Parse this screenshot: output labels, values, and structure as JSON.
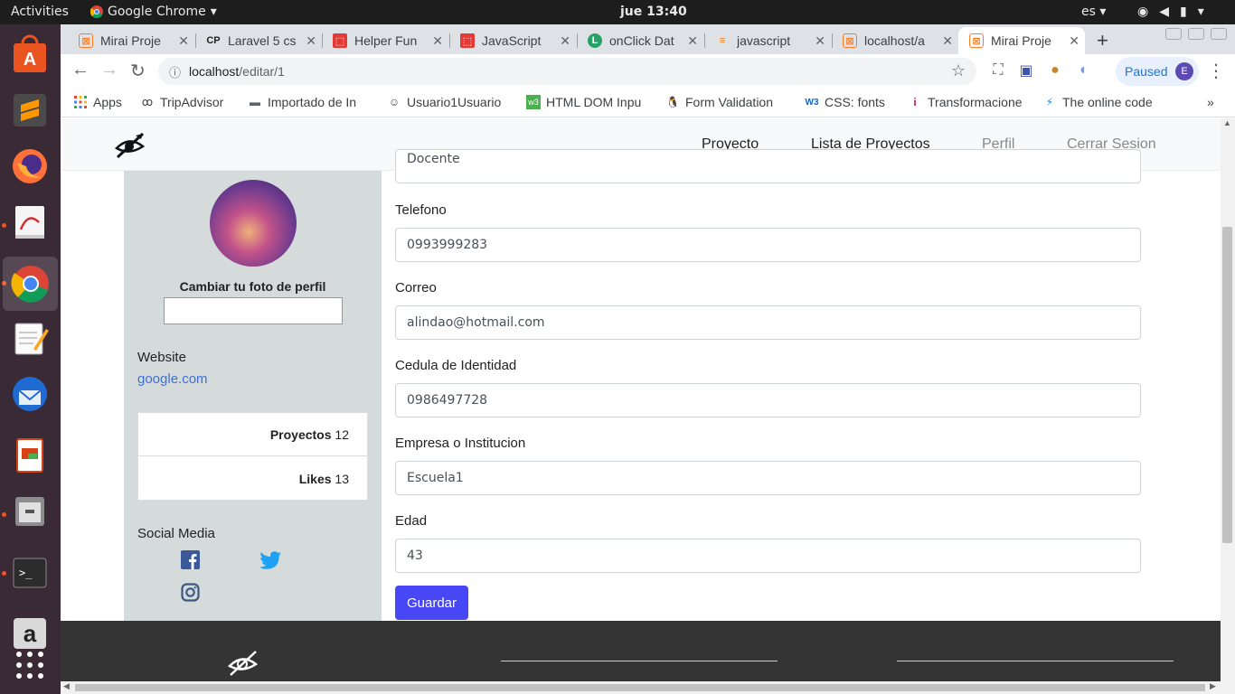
{
  "os": {
    "activities": "Activities",
    "app_name": "Google Chrome",
    "clock": "jue 13:40",
    "lang": "es"
  },
  "tabs": [
    {
      "title": "Mirai Proje",
      "favicon": "xampp-icon",
      "active": false
    },
    {
      "title": "Laravel 5 cs",
      "favicon": "cp-icon",
      "active": false
    },
    {
      "title": "Helper Fun",
      "favicon": "laravel-icon",
      "active": false
    },
    {
      "title": "JavaScript",
      "favicon": "laravel-icon",
      "active": false
    },
    {
      "title": "onClick Dat",
      "favicon": "l-icon",
      "active": false
    },
    {
      "title": "javascript",
      "favicon": "stackoverflow-icon",
      "active": false
    },
    {
      "title": "localhost/a",
      "favicon": "xampp-icon",
      "active": false
    },
    {
      "title": "Mirai Proje",
      "favicon": "xampp-icon",
      "active": true
    }
  ],
  "omnibox": {
    "host": "localhost",
    "path": "/editar/1"
  },
  "profile": {
    "label": "Paused",
    "initial": "E"
  },
  "bookmarks": [
    {
      "label": "Apps"
    },
    {
      "label": "TripAdvisor"
    },
    {
      "label": "Importado de In"
    },
    {
      "label": "Usuario1Usuario"
    },
    {
      "label": "HTML DOM Inpu"
    },
    {
      "label": "Form Validation"
    },
    {
      "label": "CSS: fonts"
    },
    {
      "label": "Transformacione"
    },
    {
      "label": "The online code"
    }
  ],
  "navbar": {
    "links": [
      "Proyecto",
      "Lista de Proyectos",
      "Perfil",
      "Cerrar Sesion"
    ]
  },
  "sidebar": {
    "change_photo": "Cambiar tu foto de perfil",
    "website_label": "Website",
    "website_link": "google.com",
    "stats": [
      {
        "label": "Proyectos",
        "value": "12"
      },
      {
        "label": "Likes",
        "value": "13"
      }
    ],
    "social_label": "Social Media"
  },
  "form": {
    "fields": [
      {
        "label": "Telefono",
        "value": "0993999283"
      },
      {
        "label": "Correo",
        "value": "alindao@hotmail.com"
      },
      {
        "label": "Cedula de Identidad",
        "value": "0986497728"
      },
      {
        "label": "Empresa o Institucion",
        "value": "Escuela1"
      },
      {
        "label": "Edad",
        "value": "43"
      }
    ],
    "partial_field_value": "Docente",
    "save_label": "Guardar"
  },
  "colors": {
    "accent": "#4747f5",
    "sidebar_bg": "#d5dadb",
    "footer_bg": "#343434",
    "link": "#3e6fd8"
  }
}
